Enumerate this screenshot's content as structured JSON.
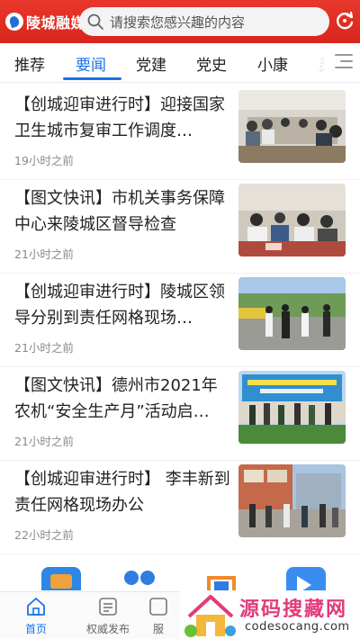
{
  "header": {
    "logo_text": "陵城融媒",
    "search_placeholder": "请搜索您感兴趣的内容",
    "brand_color": "#e1301f"
  },
  "tabs": [
    {
      "label": "推荐",
      "active": false
    },
    {
      "label": "要闻",
      "active": true
    },
    {
      "label": "党建",
      "active": false
    },
    {
      "label": "党史",
      "active": false
    },
    {
      "label": "小康",
      "active": false
    },
    {
      "label": "灵",
      "active": false
    }
  ],
  "news": [
    {
      "title": "【创城迎审进行时】迎接国家卫生城市复审工作调度…",
      "time": "19小时之前",
      "image": "meeting-room-photo"
    },
    {
      "title": "【图文快讯】市机关事务保障中心来陵城区督导检查",
      "time": "21小时之前",
      "image": "meeting-table-photo"
    },
    {
      "title": "【创城迎审进行时】陵城区领导分别到责任网格现场…",
      "time": "21小时之前",
      "image": "street-inspection-photo"
    },
    {
      "title": "【图文快讯】德州市2021年农机“安全生产月”活动启…",
      "time": "21小时之前",
      "image": "outdoor-event-photo"
    },
    {
      "title": "【创城迎审进行时】 李丰新到责任网格现场办公",
      "time": "22小时之前",
      "image": "street-office-photo"
    }
  ],
  "apps": [
    "wallet-app-icon",
    "people-app-icon",
    "building-app-icon",
    "video-app-icon"
  ],
  "bottom_nav": [
    {
      "label": "首页",
      "active": true
    },
    {
      "label": "权威发布",
      "active": false
    },
    {
      "label": "服",
      "active": false
    }
  ],
  "watermark": {
    "title": "源码搜藏网",
    "url": "codesocang.com"
  },
  "accent_color": "#1a73e8"
}
